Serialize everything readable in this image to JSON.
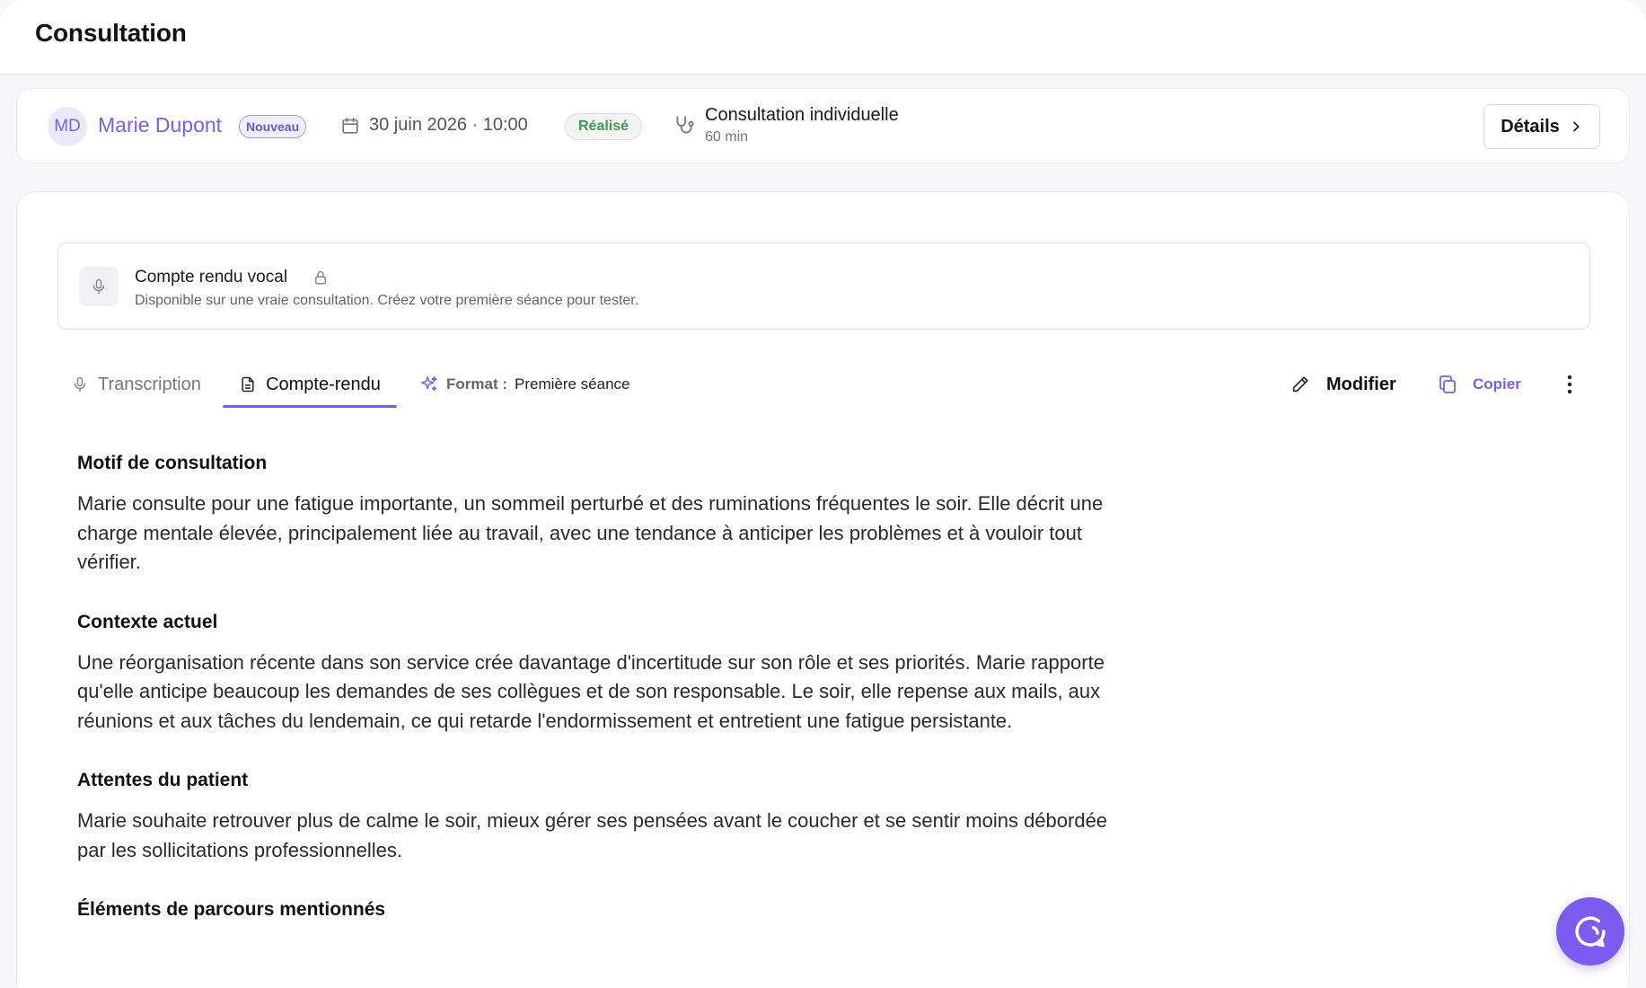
{
  "header": {
    "title": "Consultation"
  },
  "appointment": {
    "avatar_initials": "MD",
    "patient_name": "Marie Dupont",
    "patient_badge": "Nouveau",
    "date": "30 juin 2026 · 10:00",
    "status": "Réalisé",
    "type": "Consultation individuelle",
    "duration": "60 min",
    "details_label": "Détails"
  },
  "vocal_report": {
    "title": "Compte rendu vocal",
    "description": "Disponible sur une vraie consultation. Créez votre première séance pour tester."
  },
  "tabs": [
    {
      "label": "Transcription",
      "active": false
    },
    {
      "label": "Compte-rendu",
      "active": true
    }
  ],
  "format": {
    "label": "Format :",
    "value": "Première séance"
  },
  "actions": {
    "modify_label": "Modifier",
    "copy_label": "Copier"
  },
  "report": {
    "sections": [
      {
        "title": "Motif de consultation",
        "body": "Marie consulte pour une fatigue importante, un sommeil perturbé et des ruminations fréquentes le soir. Elle décrit une charge mentale élevée, principalement liée au travail, avec une tendance à anticiper les problèmes et à vouloir tout vérifier."
      },
      {
        "title": "Contexte actuel",
        "body": "Une réorganisation récente dans son service crée davantage d'incertitude sur son rôle et ses priorités. Marie rapporte qu'elle anticipe beaucoup les demandes de ses collègues et de son responsable. Le soir, elle repense aux mails, aux réunions et aux tâches du lendemain, ce qui retarde l'endormissement et entretient une fatigue persistante."
      },
      {
        "title": "Attentes du patient",
        "body": "Marie souhaite retrouver plus de calme le soir, mieux gérer ses pensées avant le coucher et se sentir moins débordée par les sollicitations professionnelles."
      },
      {
        "title": "Éléments de parcours mentionnés",
        "body": ""
      }
    ]
  },
  "colors": {
    "accent": "#7c5cf0",
    "success": "#3f9a50"
  }
}
